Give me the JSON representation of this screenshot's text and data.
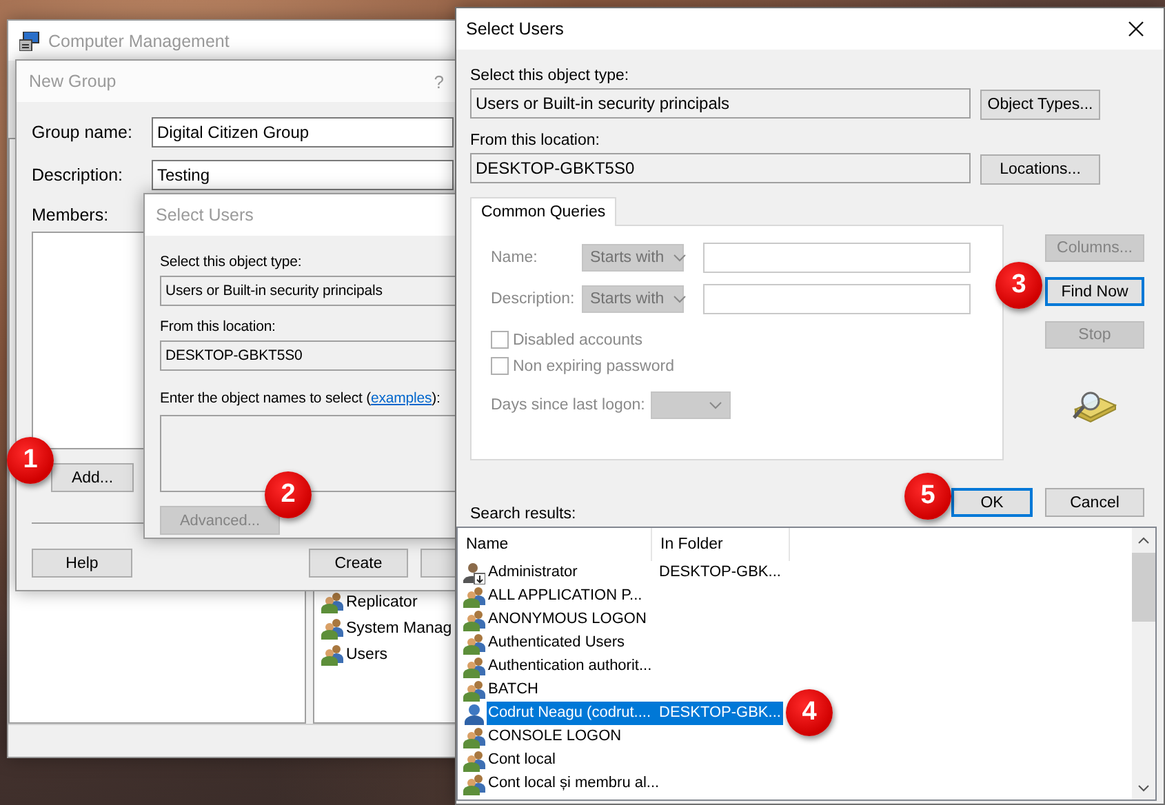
{
  "computer_management": {
    "title": "Computer Management",
    "active": false,
    "list_items": [
      {
        "label": "Replicator"
      },
      {
        "label": "System Manag"
      },
      {
        "label": "Users"
      }
    ]
  },
  "new_group": {
    "title": "New Group",
    "help_glyph": "?",
    "active": false,
    "fields": [
      {
        "label": "Group name:",
        "value": "Digital Citizen Group"
      },
      {
        "label": "Description:",
        "value": "Testing"
      }
    ],
    "members_label": "Members:",
    "add_button": {
      "label": "Add...",
      "disabled": false
    },
    "footer_buttons": [
      {
        "label": "Help",
        "disabled": false
      },
      {
        "label": "Create",
        "disabled": false
      }
    ]
  },
  "select_users_small": {
    "title": "Select Users",
    "active": false,
    "object_type_label": "Select this object type:",
    "object_type": "Users or Built-in security principals",
    "location_label": "From this location:",
    "location": "DESKTOP-GBKT5S0",
    "names_label_start": "Enter the object names to select (",
    "names_link": "examples",
    "names_label_end": "):",
    "advanced_button": {
      "label": "Advanced...",
      "disabled": true
    }
  },
  "select_users": {
    "title": "Select Users",
    "active": true,
    "object_type_label": "Select this object type:",
    "object_type": "Users or Built-in security principals",
    "object_types_button": {
      "label": "Object Types...",
      "disabled": false,
      "default": false
    },
    "location_label": "From this location:",
    "location": "DESKTOP-GBKT5S0",
    "locations_button": {
      "label": "Locations...",
      "disabled": false,
      "default": false
    },
    "tabs": [
      {
        "label": "Common Queries",
        "selected": true
      }
    ],
    "query_fields": [
      {
        "label": "Name:",
        "operator": "Starts with",
        "disabled": true
      },
      {
        "label": "Description:",
        "operator": "Starts with",
        "disabled": true
      }
    ],
    "checkboxes": [
      {
        "label": "Disabled accounts",
        "checked": false,
        "disabled": true
      },
      {
        "label": "Non expiring password",
        "checked": false,
        "disabled": true
      }
    ],
    "days_field": {
      "label": "Days since last logon:",
      "disabled": true
    },
    "side_buttons": [
      {
        "label": "Columns...",
        "disabled": true,
        "default": false
      },
      {
        "label": "Find Now",
        "disabled": false,
        "default": true
      },
      {
        "label": "Stop",
        "disabled": true,
        "default": false
      }
    ],
    "dialog_buttons": [
      {
        "label": "OK",
        "disabled": false,
        "default": true
      },
      {
        "label": "Cancel",
        "disabled": false,
        "default": false
      }
    ],
    "results_label": "Search results:",
    "results": {
      "columns": [
        "Name",
        "In Folder"
      ],
      "rows": [
        {
          "kind": "admin",
          "name": "Administrator",
          "folder": "DESKTOP-GBK...",
          "selected": false
        },
        {
          "kind": "group",
          "name": "ALL APPLICATION P...",
          "selected": false
        },
        {
          "kind": "group",
          "name": "ANONYMOUS LOGON",
          "selected": false
        },
        {
          "kind": "group",
          "name": "Authenticated Users",
          "selected": false
        },
        {
          "kind": "group",
          "name": "Authentication authorit...",
          "selected": false
        },
        {
          "kind": "group",
          "name": "BATCH",
          "selected": false
        },
        {
          "kind": "user",
          "name": "Codrut Neagu (codrut....",
          "folder": "DESKTOP-GBK...",
          "selected": true
        },
        {
          "kind": "group",
          "name": "CONSOLE LOGON",
          "selected": false
        },
        {
          "kind": "group",
          "name": "Cont local",
          "selected": false
        },
        {
          "kind": "group",
          "name": "Cont local și membru al...",
          "selected": false
        }
      ]
    }
  },
  "badges": [
    {
      "label": "1"
    },
    {
      "label": "2"
    },
    {
      "label": "3"
    },
    {
      "label": "4"
    },
    {
      "label": "5"
    }
  ]
}
